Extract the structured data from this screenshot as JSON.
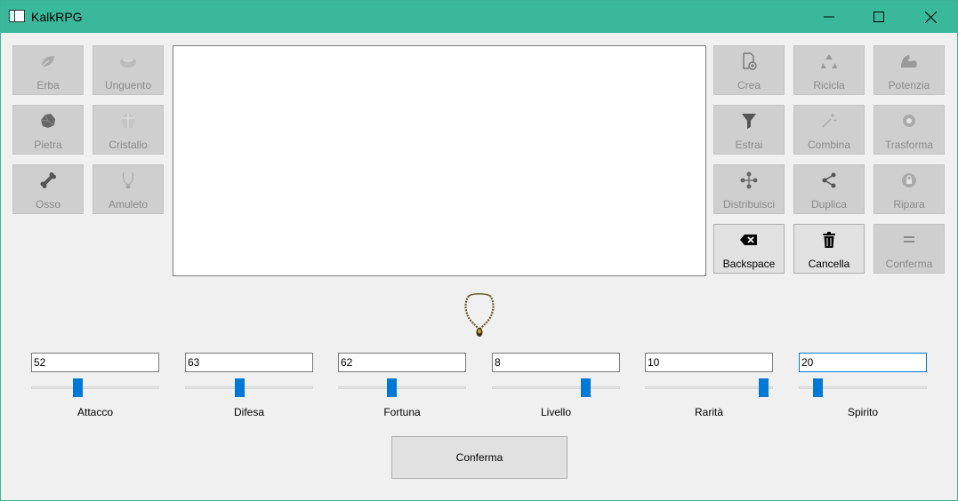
{
  "window": {
    "title": "KalkRPG"
  },
  "materials": [
    {
      "label": "Erba",
      "icon": "leaf-icon"
    },
    {
      "label": "Unguento",
      "icon": "ointment-bowl-icon"
    },
    {
      "label": "Pietra",
      "icon": "rock-icon"
    },
    {
      "label": "Cristallo",
      "icon": "crystal-icon"
    },
    {
      "label": "Osso",
      "icon": "bone-icon"
    },
    {
      "label": "Amuleto",
      "icon": "amulet-icon"
    }
  ],
  "actions": [
    {
      "label": "Crea",
      "icon": "create-file-icon",
      "enabled": false
    },
    {
      "label": "Ricicla",
      "icon": "recycle-icon",
      "enabled": false
    },
    {
      "label": "Potenzia",
      "icon": "muscle-arm-icon",
      "enabled": false
    },
    {
      "label": "Estrai",
      "icon": "funnel-icon",
      "enabled": false
    },
    {
      "label": "Combina",
      "icon": "sparkle-wand-icon",
      "enabled": false
    },
    {
      "label": "Trasforma",
      "icon": "transform-circle-icon",
      "enabled": false
    },
    {
      "label": "Distribuisci",
      "icon": "distribute-nodes-icon",
      "enabled": false
    },
    {
      "label": "Duplica",
      "icon": "share-icon",
      "enabled": false
    },
    {
      "label": "Ripara",
      "icon": "repair-lock-icon",
      "enabled": false
    },
    {
      "label": "Backspace",
      "icon": "backspace-icon",
      "enabled": true
    },
    {
      "label": "Cancella",
      "icon": "trash-icon",
      "enabled": true
    },
    {
      "label": "Conferma",
      "icon": "equals-icon",
      "enabled": false
    }
  ],
  "stats": [
    {
      "label": "Attacco",
      "value": "52",
      "slider": 0.35
    },
    {
      "label": "Difesa",
      "value": "63",
      "slider": 0.42
    },
    {
      "label": "Fortuna",
      "value": "62",
      "slider": 0.41
    },
    {
      "label": "Livello",
      "value": "8",
      "slider": 0.75
    },
    {
      "label": "Rarità",
      "value": "10",
      "slider": 0.96
    },
    {
      "label": "Spirito",
      "value": "20",
      "slider": 0.12
    }
  ],
  "confirm_button": {
    "label": "Conferma"
  },
  "colors": {
    "titlebar": "#3ab89c",
    "slider_thumb": "#0078d7",
    "focus_border": "#0078d7"
  }
}
